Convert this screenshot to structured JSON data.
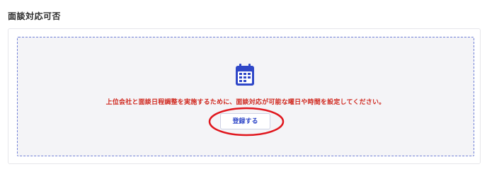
{
  "section": {
    "title": "面談対応可否"
  },
  "empty_state": {
    "icon": "calendar-icon",
    "message": "上位会社と面談日程調整を実施するために、面談対応が可能な曜日や時間を設定してください。",
    "button_label": "登録する"
  },
  "colors": {
    "accent": "#2f47c8",
    "warning_text": "#d0281f",
    "highlight_ring": "#e0161d",
    "dashed_border": "#6f7fd6",
    "empty_bg": "#f4f4f7"
  }
}
